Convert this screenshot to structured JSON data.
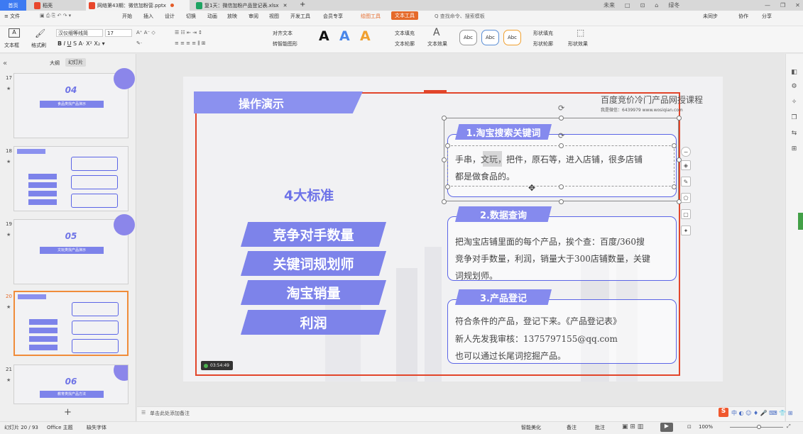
{
  "titlebar": {
    "home": "首页",
    "tabs": [
      {
        "label": "稻壳",
        "color": "#e8462c"
      },
      {
        "label": "网络第43期：微信加粉营.pptx",
        "color": "#e8462c"
      },
      {
        "label": "复1天：微信加粉产品登记表.xlsx",
        "color": "#1ea362"
      }
    ],
    "new_tab": "+",
    "right_items": [
      "未来",
      "□",
      "⊡",
      "⌂",
      "绿冬"
    ],
    "win_controls": [
      "—",
      "❐",
      "✕"
    ]
  },
  "menubar": {
    "file": "≡ 文件",
    "items": [
      "开始",
      "插入",
      "设计",
      "切换",
      "动画",
      "放映",
      "审阅",
      "视图",
      "开发工具",
      "会员专享"
    ],
    "drawing_tools": "绘图工具",
    "text_tools": "文本工具",
    "search": "Q 查找命令、搜索模板",
    "right": [
      "未同步",
      "协作",
      "分享"
    ]
  },
  "ribbon": {
    "textbox": "文本框",
    "format_painter": "格式刷",
    "font_name": "汉仪细等线简",
    "font_size": "17",
    "align_text": "对齐文本",
    "smart_art": "转智能图形",
    "text_fill": "文本填充",
    "text_outline": "文本轮廓",
    "text_effect": "文本效果",
    "shape_styles": [
      "Abc",
      "Abc",
      "Abc"
    ],
    "shape_fill": "形状填充",
    "shape_outline": "形状轮廓",
    "shape_effect": "形状效果"
  },
  "leftpanel": {
    "tabs": [
      "大纲",
      "幻灯片"
    ],
    "slides": [
      {
        "num": "17",
        "big": "04",
        "sub": "食品类找产品演示"
      },
      {
        "num": "18",
        "big": "",
        "sub": ""
      },
      {
        "num": "19",
        "big": "05",
        "sub": "文玩类找产品演示"
      },
      {
        "num": "20",
        "big": "",
        "sub": ""
      },
      {
        "num": "21",
        "big": "06",
        "sub": "教育类找产品方法"
      }
    ],
    "add": "+"
  },
  "slide": {
    "title": "操作演示",
    "brand": "百度竞价冷门产品网授课程",
    "brand2": "我是微信：6439979  www.wosiqian.com",
    "standard": "4大标准",
    "items": [
      "竞争对手数量",
      "关键词规划师",
      "淘宝销量",
      "利润"
    ],
    "sections": [
      {
        "header": "1.淘宝搜索关键词",
        "lines": [
          "手串，文玩，把件，原石等，进入店铺，很多店铺",
          "都是做食品的。"
        ]
      },
      {
        "header": "2.数据查询",
        "lines": [
          "把淘宝店铺里面的每个产品，挨个查：百度/360搜",
          "竞争对手数量，利润，销量大于300店铺数量，关键",
          "词规划师。"
        ]
      },
      {
        "header": "3.产品登记",
        "lines": [
          "符合条件的产品，登记下来。《产品登记表》",
          "新人先发我审核：1375797155@qq.com",
          "也可以通过长尾词挖掘产品。"
        ]
      }
    ],
    "timer": "03:54:49"
  },
  "notes": {
    "placeholder": "单击此处添加备注"
  },
  "statusbar": {
    "slide_count": "幻灯片 20 / 93",
    "theme": "Office 主题",
    "font_missing": "缺失字体",
    "smart": "智能美化",
    "notes": "备注",
    "comment": "批注",
    "zoom": "100%"
  }
}
